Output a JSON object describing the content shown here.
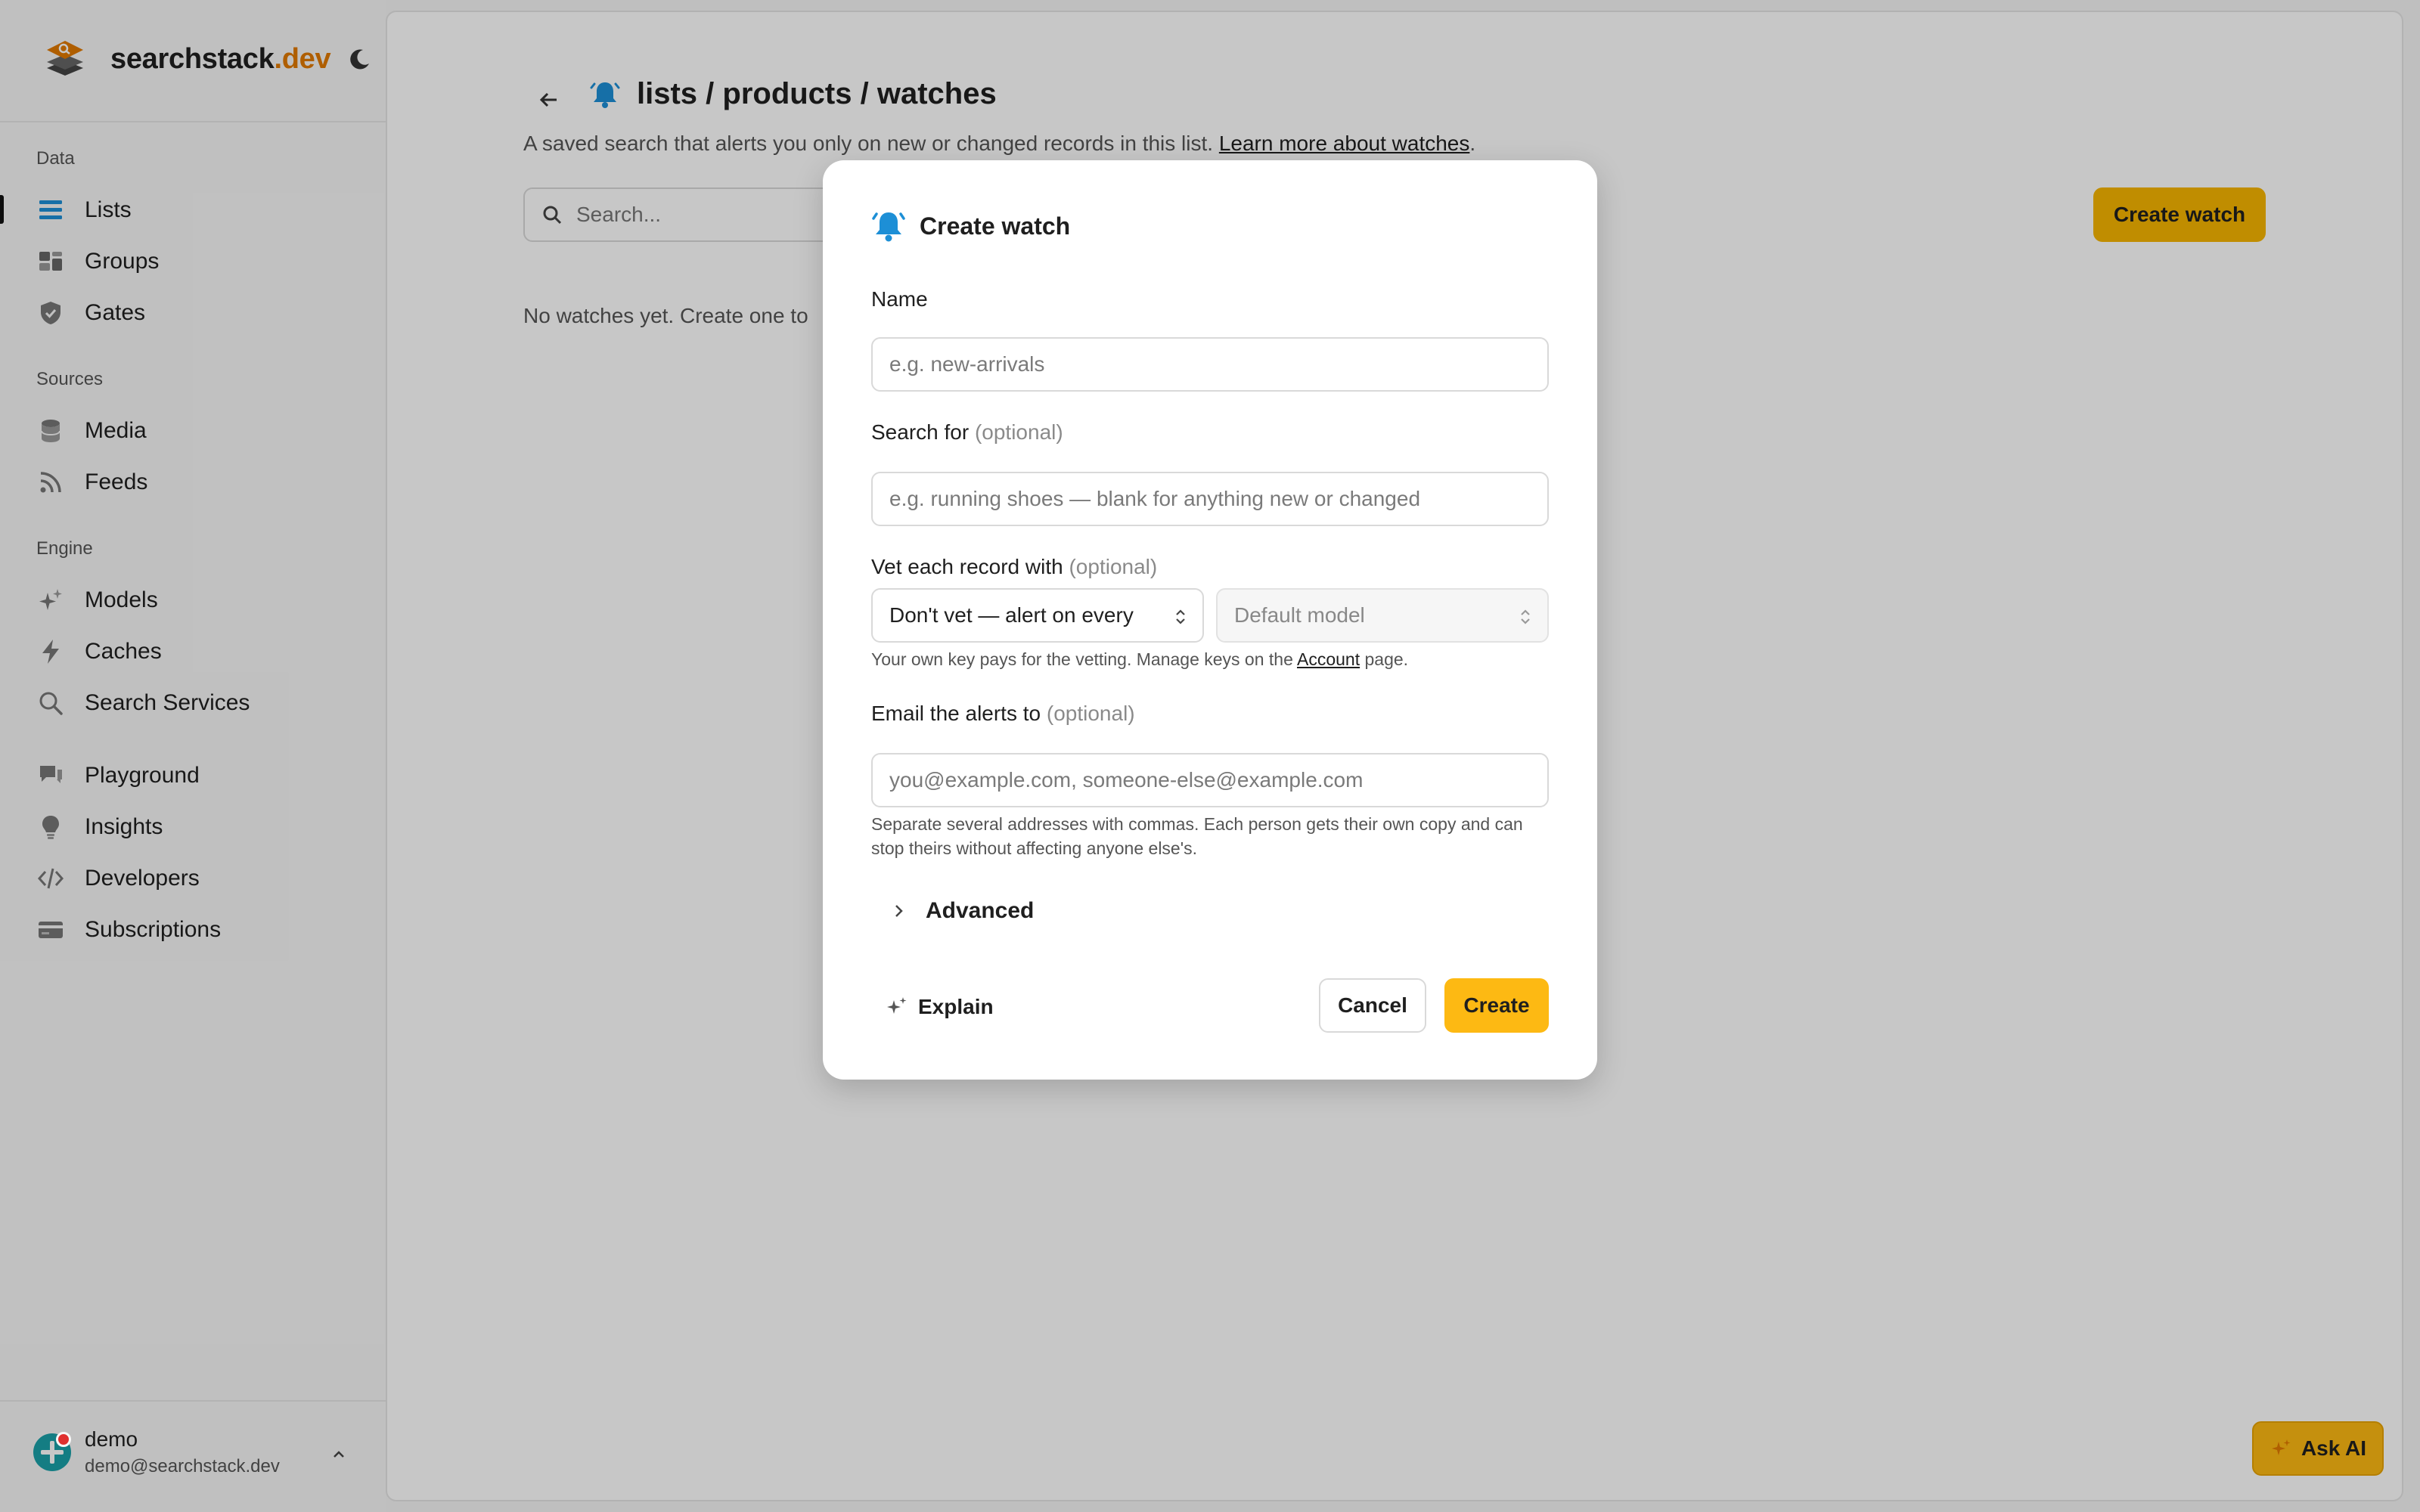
{
  "brand": {
    "name": "searchstack",
    "tld": ".dev"
  },
  "sidebar": {
    "sections": [
      {
        "title": "Data",
        "items": [
          {
            "label": "Lists",
            "icon": "list-icon",
            "active": true
          },
          {
            "label": "Groups",
            "icon": "groups-icon"
          },
          {
            "label": "Gates",
            "icon": "shield-icon"
          }
        ]
      },
      {
        "title": "Sources",
        "items": [
          {
            "label": "Media",
            "icon": "database-icon"
          },
          {
            "label": "Feeds",
            "icon": "rss-icon"
          }
        ]
      },
      {
        "title": "Engine",
        "items": [
          {
            "label": "Models",
            "icon": "sparkles-icon"
          },
          {
            "label": "Caches",
            "icon": "bolt-icon"
          },
          {
            "label": "Search Services",
            "icon": "search-icon"
          }
        ]
      },
      {
        "title": "",
        "items": [
          {
            "label": "Playground",
            "icon": "chat-icon"
          },
          {
            "label": "Insights",
            "icon": "lightbulb-icon"
          },
          {
            "label": "Developers",
            "icon": "code-icon"
          },
          {
            "label": "Subscriptions",
            "icon": "card-icon"
          }
        ]
      }
    ]
  },
  "user": {
    "name": "demo",
    "email": "demo@searchstack.dev"
  },
  "page": {
    "title": "lists / products / watches",
    "description": "A saved search that alerts you only on new or changed records in this list.",
    "learn_more": "Learn more about watches",
    "description_end": ".",
    "search_placeholder": "Search...",
    "create_button": "Create watch",
    "empty_message": "No watches yet. Create one to"
  },
  "modal": {
    "title": "Create watch",
    "name_label": "Name",
    "name_placeholder": "e.g. new-arrivals",
    "search_label": "Search for",
    "search_optional": "(optional)",
    "search_placeholder": "e.g. running shoes — blank for anything new or changed",
    "vet_label": "Vet each record with",
    "vet_optional": "(optional)",
    "vet_selected": "Don't vet — alert on every",
    "model_selected": "Default model",
    "vet_help_pre": "Your own key pays for the vetting. Manage keys on the",
    "vet_help_link": "Account",
    "vet_help_post": "page.",
    "email_label": "Email the alerts to",
    "email_optional": "(optional)",
    "email_placeholder": "you@example.com, someone-else@example.com",
    "email_help": "Separate several addresses with commas. Each person gets their own copy and can stop theirs without affecting anyone else's.",
    "advanced_label": "Advanced",
    "explain_label": "Explain",
    "cancel_label": "Cancel",
    "create_label": "Create"
  },
  "ask_ai": "Ask AI",
  "colors": {
    "accent": "#fdb913",
    "brand_tld": "#e07900",
    "bell": "#1d8fd6"
  }
}
